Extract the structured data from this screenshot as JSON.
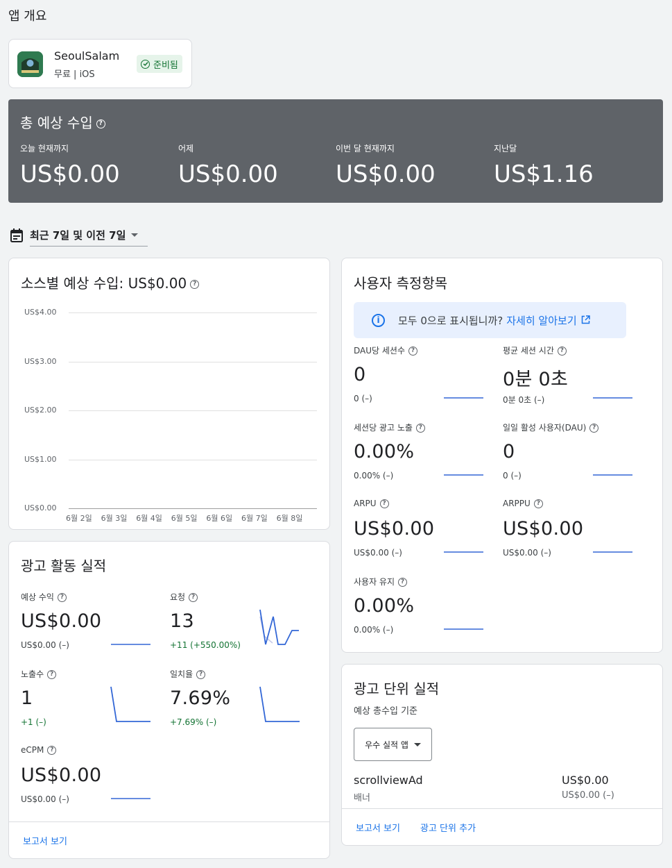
{
  "page_title": "앱 개요",
  "app": {
    "name": "SeoulSalam",
    "meta": "무료 | iOS",
    "status": "준비됨"
  },
  "earnings": {
    "title": "총 예상 수입",
    "items": [
      {
        "label": "오늘 현재까지",
        "value": "US$0.00"
      },
      {
        "label": "어제",
        "value": "US$0.00"
      },
      {
        "label": "이번 달 현재까지",
        "value": "US$0.00"
      },
      {
        "label": "지난달",
        "value": "US$1.16"
      }
    ]
  },
  "date_range": {
    "label": "최근 7일 및 이전 7일"
  },
  "source_earnings": {
    "title": "소스별 예상 수입: US$0.00"
  },
  "chart_data": {
    "type": "line",
    "title": "소스별 예상 수입: US$0.00",
    "categories": [
      "6월 2일",
      "6월 3일",
      "6월 4일",
      "6월 5일",
      "6월 6일",
      "6월 7일",
      "6월 8일"
    ],
    "y_ticks": [
      "US$4.00",
      "US$3.00",
      "US$2.00",
      "US$1.00",
      "US$0.00"
    ],
    "ylim": [
      0,
      4
    ],
    "series": [
      {
        "values": [
          0,
          0,
          0,
          0,
          0,
          0,
          0
        ]
      }
    ],
    "grid": true
  },
  "ad_performance": {
    "title": "광고 활동 실적",
    "metrics": [
      {
        "label": "예상 수익",
        "value": "US$0.00",
        "sub": "US$0.00 (–)"
      },
      {
        "label": "요청",
        "value": "13",
        "sub": "+11 (+550.00%)"
      },
      {
        "label": "노출수",
        "value": "1",
        "sub": "+1 (–)"
      },
      {
        "label": "일치율",
        "value": "7.69%",
        "sub": "+7.69% (–)"
      },
      {
        "label": "eCPM",
        "value": "US$0.00",
        "sub": "US$0.00 (–)"
      }
    ],
    "link": "보고서 보기"
  },
  "user_metrics": {
    "title": "사용자 측정항목",
    "info_text": "모두 0으로 표시됩니까?",
    "info_link": "자세히 알아보기",
    "metrics": [
      {
        "label": "DAU당 세션수",
        "value": "0",
        "sub": "0 (–)"
      },
      {
        "label": "평균 세션 시간",
        "value": "0분 0초",
        "sub": "0분 0초 (–)"
      },
      {
        "label": "세션당 광고 노출",
        "value": "0.00%",
        "sub": "0.00% (–)"
      },
      {
        "label": "일일 활성 사용자(DAU)",
        "value": "0",
        "sub": "0 (–)"
      },
      {
        "label": "ARPU",
        "value": "US$0.00",
        "sub": "US$0.00 (–)"
      },
      {
        "label": "ARPPU",
        "value": "US$0.00",
        "sub": "US$0.00 (–)"
      },
      {
        "label": "사용자 유지",
        "value": "0.00%",
        "sub": "0.00% (–)"
      }
    ]
  },
  "ad_units": {
    "title": "광고 단위 실적",
    "subtitle": "예상 총수입 기준",
    "dropdown": "우수 실적 앱",
    "unit_name": "scrollviewAd",
    "unit_type": "배너",
    "unit_value": "US$0.00",
    "unit_sub": "US$0.00 (–)",
    "link_report": "보고서 보기",
    "link_add": "광고 단위 추가"
  },
  "colors": {
    "accent": "#1a73e8",
    "positive": "#137333",
    "banner_bg": "#5f6368",
    "status_bg": "#e6f4ea"
  }
}
